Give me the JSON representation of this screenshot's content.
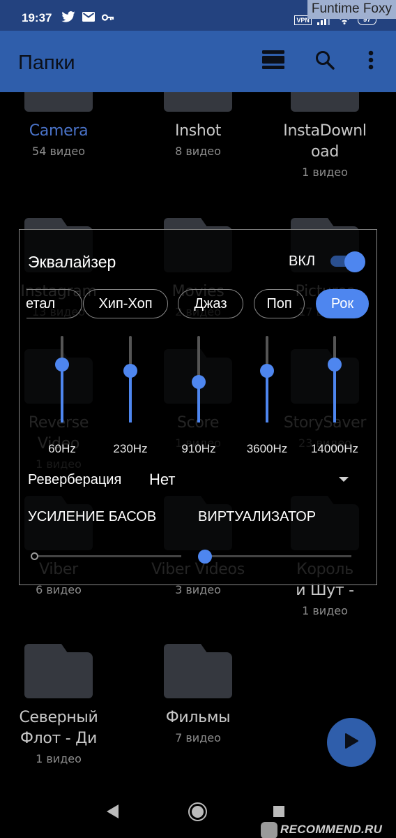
{
  "status_bar": {
    "time": "19:37",
    "left_icons": [
      "twitter-icon",
      "mail-icon",
      "key-icon"
    ],
    "vpn": "VPN",
    "battery": "97",
    "overlay_label": "Funtime Foxy"
  },
  "app_bar": {
    "title": "Папки",
    "actions": [
      "view-list-icon",
      "search-icon",
      "more-vert-icon"
    ]
  },
  "folders": [
    {
      "name": "Camera",
      "count": "54 видео",
      "active": true
    },
    {
      "name": "Inshot",
      "count": "8 видео"
    },
    {
      "name": "InstaDownl oad",
      "name_lines": [
        "InstaDownl",
        "oad"
      ],
      "count": "1 видео"
    },
    {
      "name": "Instagram",
      "count": "13 видео"
    },
    {
      "name": "Movies",
      "count": "2 видео"
    },
    {
      "name": "Pictures",
      "count": "17 видео"
    },
    {
      "name": "Reverse Video",
      "name_lines": [
        "Reverse",
        "Video"
      ],
      "count": "1 видео"
    },
    {
      "name": "Score",
      "count": "1 видео"
    },
    {
      "name": "StorySaver",
      "count": "23 видео"
    },
    {
      "name": "Viber",
      "count": "6 видео"
    },
    {
      "name": "Viber Videos",
      "count": "3 видео"
    },
    {
      "name": "Король и Шут -",
      "name_lines": [
        "Король",
        "и Шут -"
      ],
      "count": "1 видео"
    },
    {
      "name": "Северный Флот - Ди",
      "name_lines": [
        "Северный",
        "Флот - Ди"
      ],
      "count": "1 видео"
    },
    {
      "name": "Фильмы",
      "count": "7 видео"
    }
  ],
  "equalizer": {
    "title": "Эквалайзер",
    "enabled_label": "ВКЛ",
    "enabled": true,
    "presets": [
      "етал",
      "Хип-Хоп",
      "Джаз",
      "Поп",
      "Рок"
    ],
    "selected_preset": "Рок",
    "bands": [
      {
        "label": "60Hz",
        "level": 0.67
      },
      {
        "label": "230Hz",
        "level": 0.6
      },
      {
        "label": "910Hz",
        "level": 0.47
      },
      {
        "label": "3600Hz",
        "level": 0.6
      },
      {
        "label": "14000Hz",
        "level": 0.67
      }
    ],
    "reverb_label": "Реверберация",
    "reverb_value": "Нет",
    "bass_label": "УСИЛЕНИЕ БАСОВ",
    "bass_level": 0.0,
    "virtualizer_label": "ВИРТУАЛИЗАТОР",
    "virtualizer_level": 0.0
  },
  "fab": {
    "icon": "play-icon"
  },
  "nav": {
    "back": "back-icon",
    "home": "home-icon",
    "recents": "recents-icon"
  },
  "watermark": "RECOMMEND.RU",
  "colors": {
    "accent": "#4e86ef",
    "app_bar": "#2f5eab",
    "status_bar": "#23427f",
    "folder": "#35383f"
  }
}
